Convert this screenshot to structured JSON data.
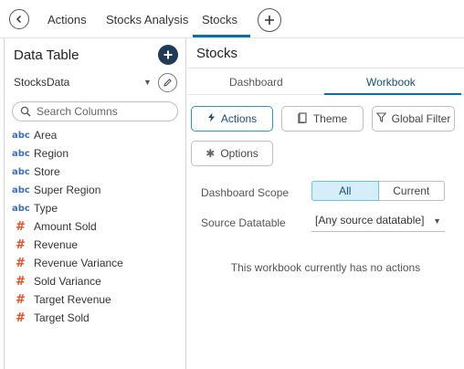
{
  "tabs": {
    "items": [
      "Actions",
      "Stocks Analysis",
      "Stocks"
    ],
    "active": "Stocks"
  },
  "left_panel": {
    "title": "Data Table",
    "datasource": "StocksData",
    "search_placeholder": "Search Columns",
    "columns": [
      {
        "type": "abc",
        "name": "Area"
      },
      {
        "type": "abc",
        "name": "Region"
      },
      {
        "type": "abc",
        "name": "Store"
      },
      {
        "type": "abc",
        "name": "Super Region"
      },
      {
        "type": "abc",
        "name": "Type"
      },
      {
        "type": "#",
        "name": "Amount Sold"
      },
      {
        "type": "#",
        "name": "Revenue"
      },
      {
        "type": "#",
        "name": "Revenue Variance"
      },
      {
        "type": "#",
        "name": "Sold Variance"
      },
      {
        "type": "#",
        "name": "Target Revenue"
      },
      {
        "type": "#",
        "name": "Target Sold"
      }
    ]
  },
  "right_panel": {
    "title": "Stocks",
    "subtabs": [
      "Dashboard",
      "Workbook"
    ],
    "active_subtab": "Workbook",
    "buttons": {
      "actions": "Actions",
      "theme": "Theme",
      "global_filter": "Global Filter",
      "options": "Options"
    },
    "scope_label": "Dashboard Scope",
    "scope_options": [
      "All",
      "Current"
    ],
    "scope_selected": "All",
    "source_label": "Source Datatable",
    "source_value": "[Any source datatable]",
    "empty_message": "This workbook currently has no actions"
  },
  "icons": {
    "back": "back-arrow-icon",
    "add_tab": "plus-icon",
    "add_column": "plus-icon",
    "edit": "pencil-icon",
    "search": "search-icon",
    "actions": "lightning-icon",
    "theme": "theme-icon",
    "filter": "filter-icon",
    "options": "gear-icon"
  },
  "colors": {
    "accent": "#0a6ea8",
    "add_button": "#1f3b57",
    "text_type": "#3d6fb4",
    "numeric_type": "#d9532c",
    "selected_segment": "#d5eef7"
  }
}
